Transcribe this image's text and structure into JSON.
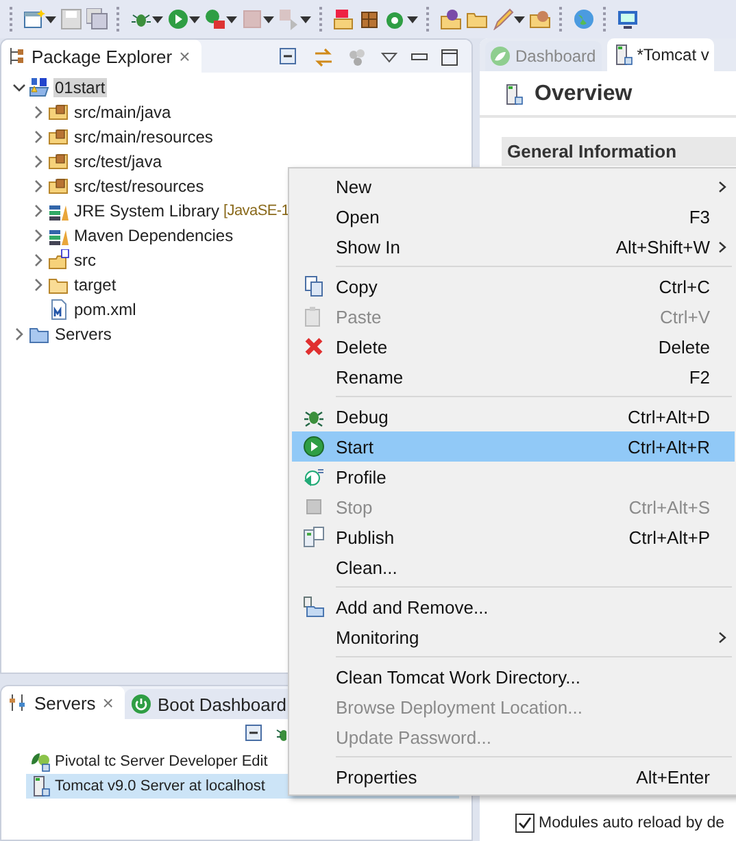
{
  "explorer": {
    "tab": {
      "label": "Package Explorer",
      "close": "×"
    },
    "tree": [
      {
        "label": "01start",
        "kind": "project",
        "expanded": true,
        "selected": true,
        "children": [
          {
            "label": "src/main/java",
            "kind": "package-folder",
            "expanded": false,
            "selected": false
          },
          {
            "label": "src/main/resources",
            "kind": "package-folder",
            "expanded": false,
            "selected": false
          },
          {
            "label": "src/test/java",
            "kind": "package-folder",
            "expanded": false,
            "selected": false
          },
          {
            "label": "src/test/resources",
            "kind": "package-folder",
            "expanded": false,
            "selected": false
          },
          {
            "label": "JRE System Library",
            "decoration": "[JavaSE-1",
            "kind": "library",
            "expanded": false,
            "selected": false
          },
          {
            "label": "Maven Dependencies",
            "kind": "library",
            "expanded": false,
            "selected": false
          },
          {
            "label": "src",
            "kind": "source-folder",
            "expanded": false,
            "selected": false
          },
          {
            "label": "target",
            "kind": "folder",
            "expanded": false,
            "selected": false
          },
          {
            "label": "pom.xml",
            "kind": "file",
            "selected": false
          }
        ]
      },
      {
        "label": "Servers",
        "kind": "servers-folder",
        "expanded": false,
        "selected": false
      }
    ]
  },
  "servers_view": {
    "tabs": [
      {
        "label": "Servers",
        "close": "×",
        "selected": true
      },
      {
        "label": "Boot Dashboard",
        "selected": false
      }
    ],
    "servers": [
      {
        "label": "Pivotal tc Server Developer Edit",
        "kind": "pivotal",
        "selected": false
      },
      {
        "label": "Tomcat v9.0 Server at localhost",
        "kind": "tomcat",
        "selected": true
      }
    ]
  },
  "editor": {
    "tabs": [
      {
        "label": "Dashboard",
        "kind": "dashboard",
        "selected": false
      },
      {
        "label": "*Tomcat v",
        "kind": "tomcat",
        "selected": true
      }
    ],
    "title": "Overview",
    "section": "General Information",
    "checkbox": {
      "label": "Modules auto reload by de",
      "checked": true
    }
  },
  "context_menu": {
    "groups": [
      [
        {
          "label": "New",
          "submenu": true
        },
        {
          "label": "Open",
          "shortcut": "F3"
        },
        {
          "label": "Show In",
          "shortcut": "Alt+Shift+W",
          "submenu": true
        }
      ],
      [
        {
          "label": "Copy",
          "shortcut": "Ctrl+C",
          "kind": "copy"
        },
        {
          "label": "Paste",
          "shortcut": "Ctrl+V",
          "kind": "paste",
          "disabled": true
        },
        {
          "label": "Delete",
          "shortcut": "Delete",
          "kind": "delete"
        },
        {
          "label": "Rename",
          "shortcut": "F2"
        }
      ],
      [
        {
          "label": "Debug",
          "shortcut": "Ctrl+Alt+D",
          "kind": "debug"
        },
        {
          "label": "Start",
          "shortcut": "Ctrl+Alt+R",
          "kind": "start",
          "selected": true
        },
        {
          "label": "Profile",
          "kind": "profile"
        },
        {
          "label": "Stop",
          "shortcut": "Ctrl+Alt+S",
          "kind": "stop",
          "disabled": true
        },
        {
          "label": "Publish",
          "shortcut": "Ctrl+Alt+P",
          "kind": "publish"
        },
        {
          "label": "Clean..."
        }
      ],
      [
        {
          "label": "Add and Remove...",
          "kind": "add-remove"
        },
        {
          "label": "Monitoring",
          "submenu": true
        }
      ],
      [
        {
          "label": "Clean Tomcat Work Directory..."
        },
        {
          "label": "Browse Deployment Location...",
          "disabled": true
        },
        {
          "label": "Update Password...",
          "disabled": true
        }
      ],
      [
        {
          "label": "Properties",
          "shortcut": "Alt+Enter"
        }
      ]
    ]
  }
}
